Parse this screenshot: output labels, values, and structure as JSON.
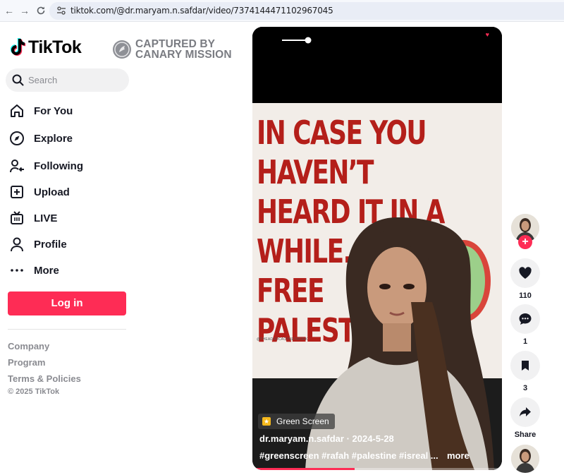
{
  "browser": {
    "url": "tiktok.com/@dr.maryam.n.safdar/video/7374144471102967045",
    "back_glyph": "←",
    "forward_glyph": "→",
    "reload_glyph": "C"
  },
  "brand": {
    "name": "TikTok"
  },
  "watermark": {
    "line1": "CAPTURED BY",
    "line2": "CANARY MISSION"
  },
  "search": {
    "placeholder": "Search"
  },
  "sidebar": {
    "items": [
      {
        "label": "For You",
        "icon": "home-icon"
      },
      {
        "label": "Explore",
        "icon": "compass-icon"
      },
      {
        "label": "Following",
        "icon": "following-icon"
      },
      {
        "label": "Upload",
        "icon": "upload-icon"
      },
      {
        "label": "LIVE",
        "icon": "live-icon"
      },
      {
        "label": "Profile",
        "icon": "profile-icon"
      },
      {
        "label": "More",
        "icon": "more-icon"
      }
    ],
    "login_label": "Log in",
    "footer": {
      "company": "Company",
      "program": "Program",
      "terms": "Terms & Policies",
      "copyright": "© 2025 TikTok"
    }
  },
  "video": {
    "headline": "IN CASE YOU\nHAVEN’T\nHEARD IT IN A\nWHILE...\nFREE\nPALESTINE",
    "poster_watermark": "@THEADVOCACYNETWORK",
    "effect_label": "Green Screen",
    "author": "dr.maryam.n.safdar",
    "separator": " · ",
    "date": "2024-5-28",
    "hashtags": "#greenscreen  #rafah  #palestine  #isreal  ...",
    "more_label": "more",
    "progress_fraction": 0.41,
    "colors": {
      "accent": "#fe2c55",
      "headline": "#b41f1a"
    }
  },
  "actions": {
    "follow_symbol": "+",
    "likes": "110",
    "comments": "1",
    "saves": "3",
    "share_label": "Share"
  }
}
